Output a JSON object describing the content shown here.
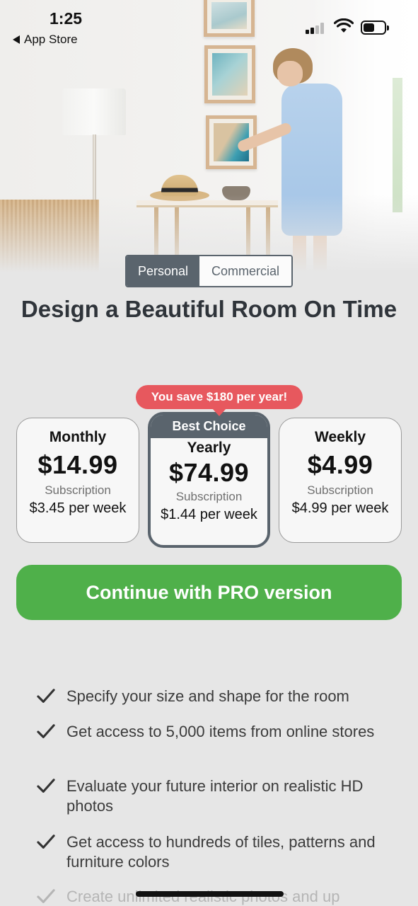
{
  "status_bar": {
    "time": "1:25",
    "back_label": "App Store",
    "signal_bars": 2,
    "battery_level_percent": 55
  },
  "hero": {
    "image_icon": "room-photo-woman-hanging-pictures"
  },
  "segmented": {
    "options": [
      "Personal",
      "Commercial"
    ],
    "selected": "Personal"
  },
  "headline": "Design a Beautiful Room On Time",
  "save_banner": "You save $180 per year!",
  "plans": [
    {
      "name": "Monthly",
      "price": "$14.99",
      "type": "Subscription",
      "per_week": "$3.45 per week",
      "selected": false
    },
    {
      "badge": "Best Choice",
      "name": "Yearly",
      "price": "$74.99",
      "type": "Subscription",
      "per_week": "$1.44 per week",
      "selected": true
    },
    {
      "name": "Weekly",
      "price": "$4.99",
      "type": "Subscription",
      "per_week": "$4.99 per week",
      "selected": false
    }
  ],
  "cta_label": "Continue with PRO version",
  "features": [
    "Specify your size and shape for the room",
    "Get access to 5,000 items from online stores",
    "Evaluate your future interior on realistic HD photos",
    "Get access to hundreds of tiles, patterns and furniture colors",
    "Create unlimited realistic photos and up"
  ],
  "colors": {
    "accent_green": "#4fb04a",
    "save_red": "#e7585e",
    "selected_border": "#5a646d",
    "background": "#e6e6e6"
  }
}
